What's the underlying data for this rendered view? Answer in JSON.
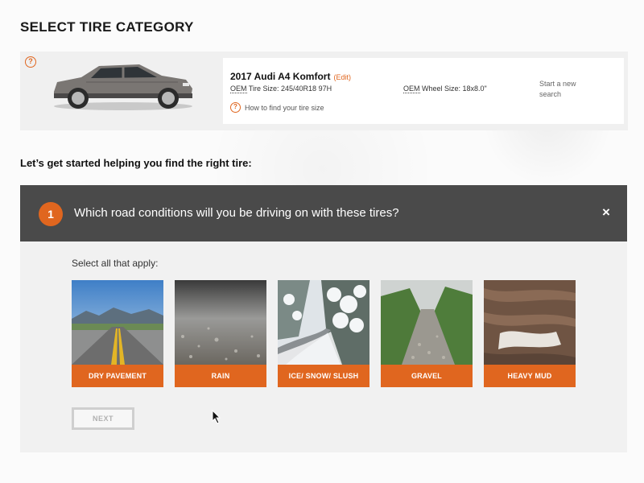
{
  "page": {
    "title": "SELECT TIRE CATEGORY"
  },
  "vehicle": {
    "name": "2017 Audi A4 Komfort",
    "edit_label": "(Edit)",
    "oem_tire_label": "OEM",
    "oem_tire_text": " Tire Size: 245/40R18 97H",
    "oem_wheel_label": "OEM",
    "oem_wheel_text": " Wheel Size: 18x8.0\"",
    "start_new_search": "Start a new search",
    "find_size_link": "How to find your tire size",
    "help_icon": "question-circle-icon",
    "car_color": "#7a7673"
  },
  "subheading": "Let’s get started helping you find the right tire:",
  "question": {
    "step": "1",
    "text": "Which road conditions will you be driving on with these tires?",
    "close_icon": "×",
    "instruction": "Select all that apply:",
    "options": [
      {
        "label": "DRY PAVEMENT"
      },
      {
        "label": "RAIN"
      },
      {
        "label": "ICE/ SNOW/ SLUSH"
      },
      {
        "label": "GRAVEL"
      },
      {
        "label": "HEAVY MUD"
      }
    ],
    "next_label": "NEXT"
  },
  "colors": {
    "accent": "#e0661f",
    "question_bar": "#4a4a4a",
    "panel": "#f1f1f1"
  }
}
